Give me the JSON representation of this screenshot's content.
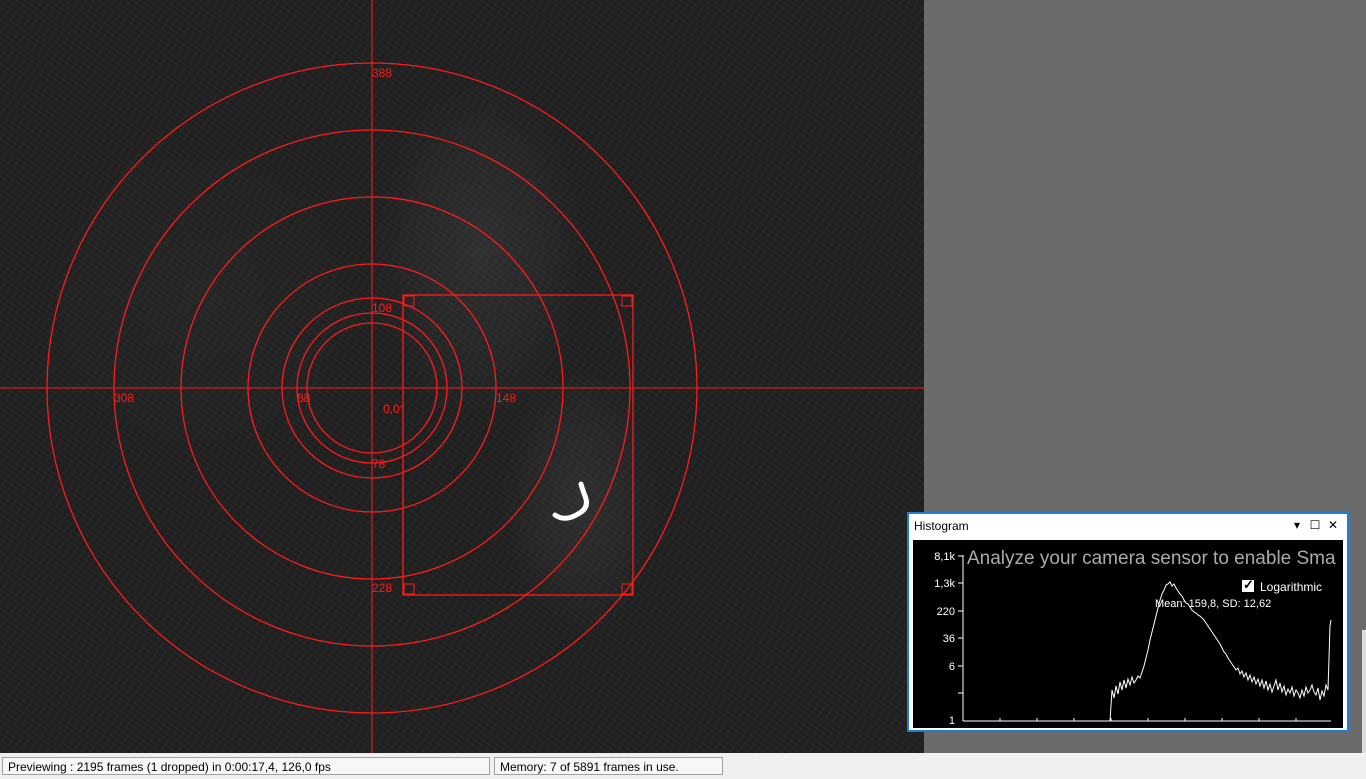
{
  "viewport": {
    "rings": [
      {
        "label": "388"
      },
      {
        "label": "308"
      },
      {
        "label": "148"
      },
      {
        "label": "108"
      },
      {
        "label": "88"
      },
      {
        "label": "78"
      }
    ],
    "center_label": "0,0°",
    "roi_label": "228",
    "overlay_color": "#ff1a1a"
  },
  "histogram": {
    "title": "Histogram",
    "buttons": {
      "dropdown": "▾",
      "maximize": "☐",
      "close": "✕"
    },
    "message": "Analyze your camera sensor to enable Sma",
    "logarithmic_label": "Logarithmic",
    "logarithmic_checked": true,
    "stats": "Mean: 159,8, SD: 12,62",
    "y_ticks": [
      "8,1k",
      "1,3k",
      "220",
      "36",
      "6",
      "1"
    ]
  },
  "status": {
    "preview": "Previewing : 2195 frames (1 dropped) in 0:00:17,4, 126,0 fps",
    "memory": "Memory: 7 of 5891 frames in use."
  }
}
